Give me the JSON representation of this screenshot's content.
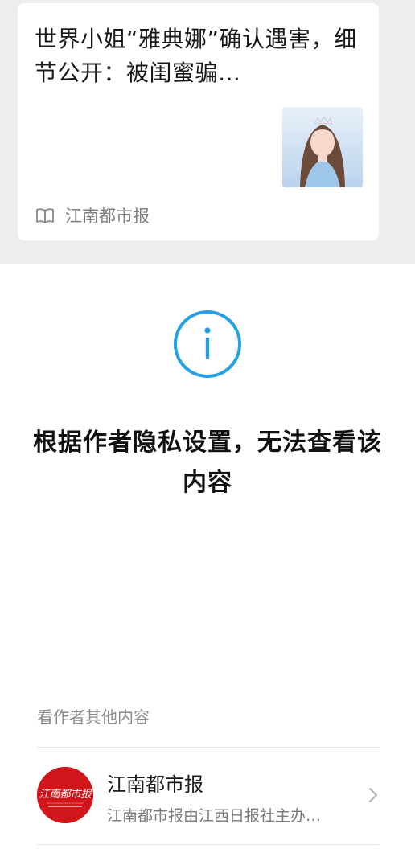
{
  "article_card": {
    "title": "世界小姐“雅典娜”确认遇害，细节公开：被闺蜜骗…",
    "source": "江南都市报",
    "thumbnail_icon": "portrait-thumbnail"
  },
  "notice": {
    "icon": "info-icon",
    "accent_color": "#25a0e6",
    "message": "根据作者隐私设置，无法查看该内容"
  },
  "author_section": {
    "header": "看作者其他内容",
    "name": "江南都市报",
    "description": "江南都市报由江西日报社主办…",
    "logo_text": "江南都市报",
    "logo_color": "#d0161b"
  }
}
